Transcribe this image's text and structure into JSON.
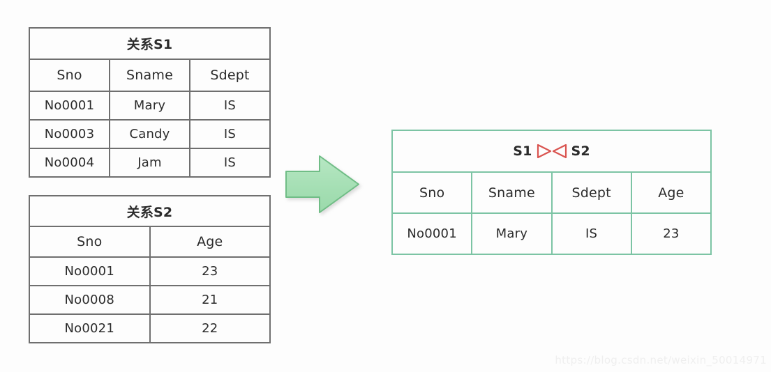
{
  "background_color": "#fdfdfd",
  "colors": {
    "table_border_gray": "#6f6f6f",
    "result_border_green": "#7cc4a4",
    "arrow_fill": "#a8e0b6",
    "arrow_stroke": "#6fbd86",
    "join_symbol_red": "#d9534f",
    "text": "#2b2b2b",
    "watermark": "#efefef"
  },
  "tables": {
    "s1": {
      "title": "关系S1",
      "columns": [
        "Sno",
        "Sname",
        "Sdept"
      ],
      "rows": [
        [
          "No0001",
          "Mary",
          "IS"
        ],
        [
          "No0003",
          "Candy",
          "IS"
        ],
        [
          "No0004",
          "Jam",
          "IS"
        ]
      ]
    },
    "s2": {
      "title": "关系S2",
      "columns": [
        "Sno",
        "Age"
      ],
      "rows": [
        [
          "No0001",
          "23"
        ],
        [
          "No0008",
          "21"
        ],
        [
          "No0021",
          "22"
        ]
      ]
    },
    "result": {
      "title_left": "S1",
      "title_symbol": "▷◁",
      "title_symbol_name": "natural-join-bowtie",
      "title_right": "S2",
      "columns": [
        "Sno",
        "Sname",
        "Sdept",
        "Age"
      ],
      "rows": [
        [
          "No0001",
          "Mary",
          "IS",
          "23"
        ]
      ]
    }
  },
  "arrow": {
    "icon": "right-block-arrow",
    "direction": "right"
  },
  "watermark": {
    "text": "https://blog.csdn.net/weixin_50014971"
  }
}
